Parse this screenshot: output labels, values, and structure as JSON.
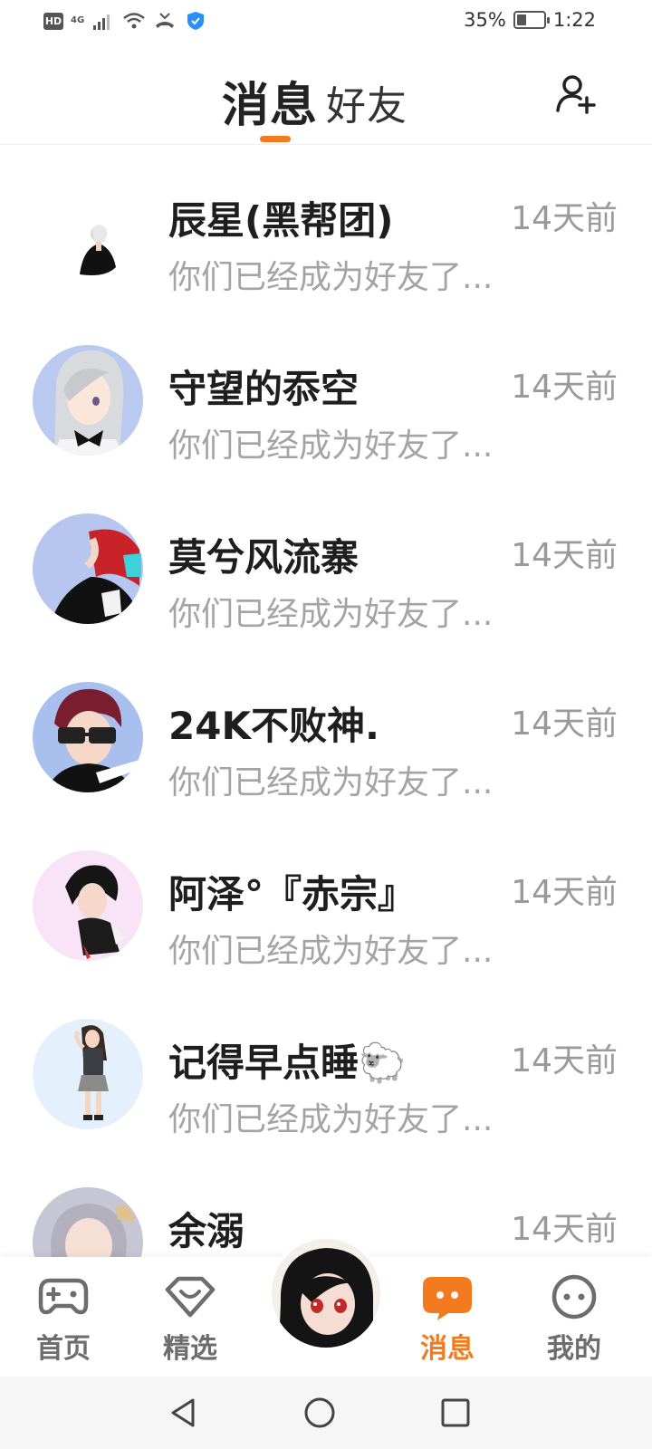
{
  "status_bar": {
    "hd": "HD",
    "signal": "4G",
    "battery": "35%",
    "battery_level": 0.35,
    "time": "1:22"
  },
  "header": {
    "tabs": [
      {
        "label": "消息",
        "active": true
      },
      {
        "label": "好友",
        "active": false
      }
    ],
    "accent_color": "#f47a1f",
    "add_friend_icon": "add-user-icon"
  },
  "messages": [
    {
      "name": "辰星(黑帮团)",
      "time": "14天前",
      "preview": "你们已经成为好友了..."
    },
    {
      "name": "守望的忝空",
      "time": "14天前",
      "preview": "你们已经成为好友了..."
    },
    {
      "name": "莫兮风流寨",
      "time": "14天前",
      "preview": "你们已经成为好友了..."
    },
    {
      "name": "24K不败神.",
      "time": "14天前",
      "preview": "你们已经成为好友了..."
    },
    {
      "name": "阿泽°『赤宗』",
      "time": "14天前",
      "preview": "你们已经成为好友了..."
    },
    {
      "name": "记得早点睡🐑",
      "time": "14天前",
      "preview": "你们已经成为好友了..."
    },
    {
      "name": "余溺",
      "time": "14天前",
      "preview": ""
    }
  ],
  "bottom_nav": {
    "items": [
      {
        "label": "首页",
        "icon": "gamepad-icon",
        "active": false
      },
      {
        "label": "精选",
        "icon": "heart-badge-icon",
        "active": false
      },
      {
        "label": "消息",
        "icon": "chat-bubble-icon",
        "active": true
      },
      {
        "label": "我的",
        "icon": "face-icon",
        "active": false
      }
    ]
  }
}
